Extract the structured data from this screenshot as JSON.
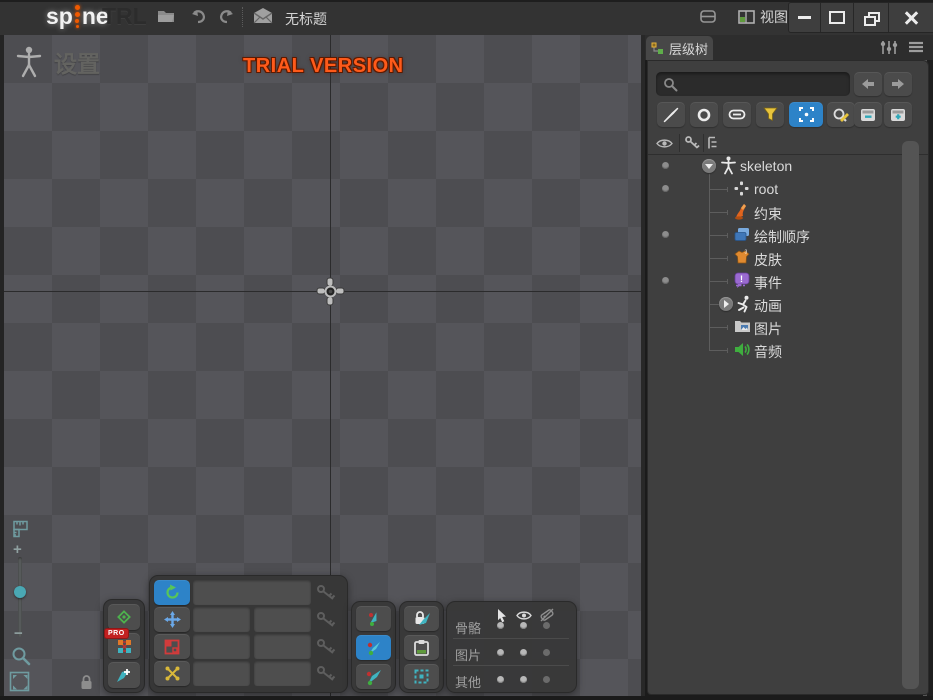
{
  "app": {
    "brand": {
      "prefix": "sp",
      "suffix": "ne",
      "edition": "TRL"
    },
    "toolbar": {
      "document_title": "无标题"
    },
    "menus": {
      "view_label": "视图"
    }
  },
  "canvas": {
    "mode_label": "设置",
    "watermark": "TRIAL VERSION"
  },
  "hierarchy": {
    "tab_label": "层级树",
    "search_value": "",
    "tree": {
      "items": [
        {
          "label": "skeleton",
          "icon": "skeleton-icon",
          "dot": true,
          "expanded": true
        },
        {
          "label": "root",
          "icon": "root-icon",
          "dot": true
        },
        {
          "label": "约束",
          "icon": "constraint-icon",
          "dot": false
        },
        {
          "label": "绘制顺序",
          "icon": "draw-order-icon",
          "dot": true
        },
        {
          "label": "皮肤",
          "icon": "skins-icon",
          "dot": false
        },
        {
          "label": "事件",
          "icon": "events-icon",
          "dot": true
        },
        {
          "label": "动画",
          "icon": "animations-icon",
          "dot": false,
          "collapsed": true
        },
        {
          "label": "图片",
          "icon": "images-icon",
          "dot": false
        },
        {
          "label": "音频",
          "icon": "audio-icon",
          "dot": false
        }
      ]
    }
  },
  "transform_panel": {
    "rows": [
      {
        "name": "rotate",
        "value": "",
        "selected": true
      },
      {
        "name": "translate",
        "value_x": "",
        "value_y": ""
      },
      {
        "name": "scale",
        "value_x": "",
        "value_y": ""
      },
      {
        "name": "shear",
        "value_x": "",
        "value_y": ""
      }
    ]
  },
  "pro_badge": "PRO",
  "visibility": {
    "rows": [
      "骨骼",
      "图片",
      "其他"
    ],
    "columns": [
      "select",
      "visible",
      "label"
    ]
  },
  "colors": {
    "accent_blue": "#2d83c8",
    "trial_orange": "#ff5a1a",
    "teal": "#4ab0bd",
    "rotate_green": "#58c558",
    "scale_red": "#d23b3b",
    "shear_gold": "#d8b83a"
  }
}
